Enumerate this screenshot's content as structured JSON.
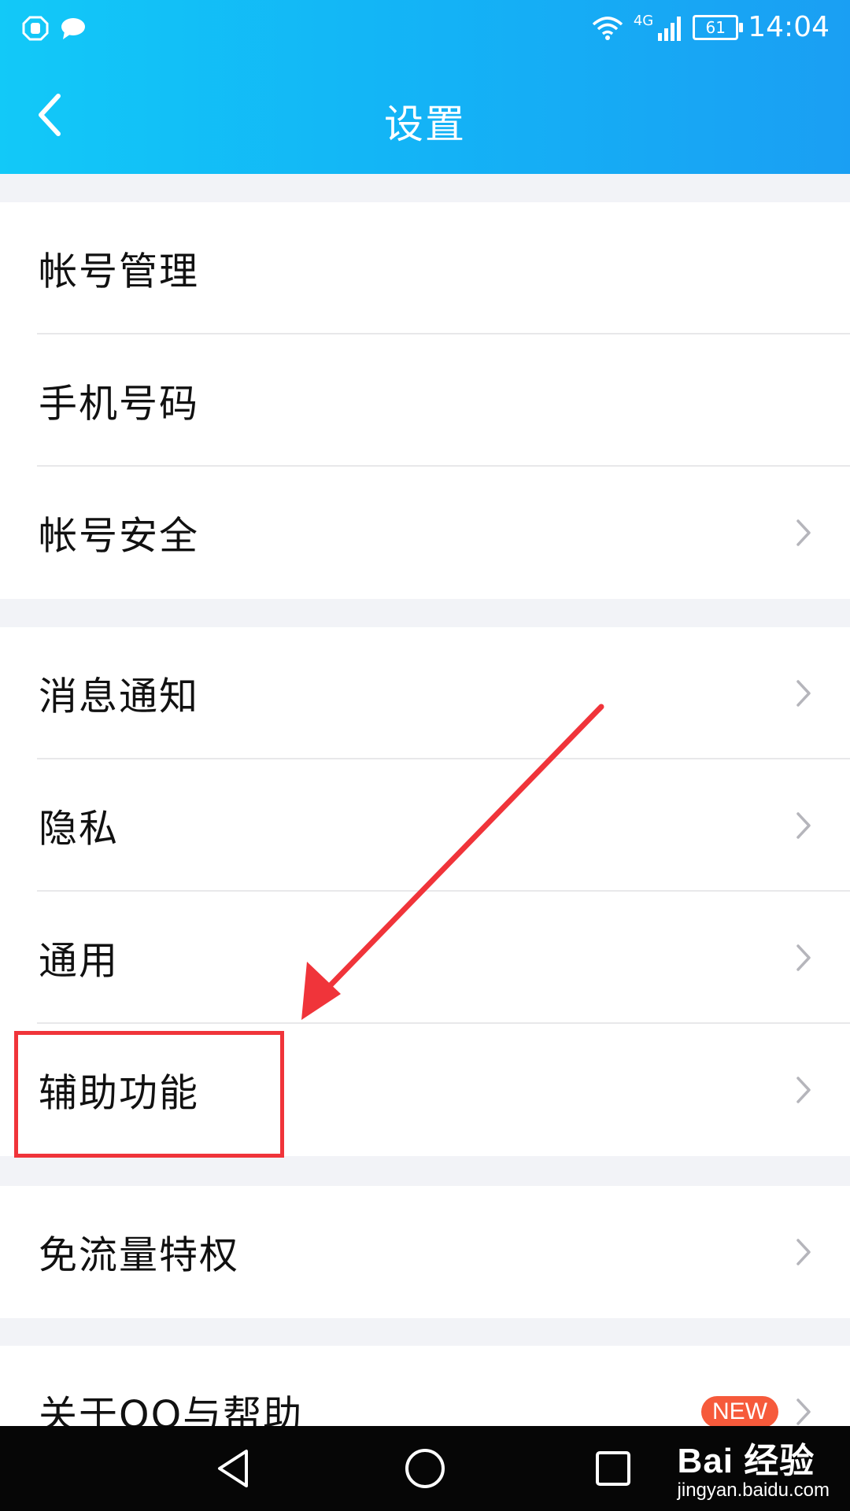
{
  "status_bar": {
    "time": "14:04",
    "battery": "61",
    "network": "4G",
    "icons": [
      "app-notification-icon",
      "message-icon",
      "wifi-icon",
      "signal-icon",
      "battery-icon"
    ]
  },
  "header": {
    "title": "设置",
    "back_icon": "back-arrow-icon",
    "gradient": [
      "#12c9f8",
      "#1a9ff3"
    ]
  },
  "groups": [
    {
      "items": [
        {
          "label": "帐号管理",
          "chevron": false
        },
        {
          "label": "手机号码",
          "chevron": false
        },
        {
          "label": "帐号安全",
          "chevron": true
        }
      ]
    },
    {
      "items": [
        {
          "label": "消息通知",
          "chevron": true
        },
        {
          "label": "隐私",
          "chevron": true
        },
        {
          "label": "通用",
          "chevron": true
        },
        {
          "label": "辅助功能",
          "chevron": true
        }
      ]
    },
    {
      "items": [
        {
          "label": "免流量特权",
          "chevron": true
        }
      ]
    },
    {
      "items": [
        {
          "label": "关于QQ与帮助",
          "chevron": true,
          "badge": "NEW"
        }
      ]
    }
  ],
  "annotation": {
    "highlight_color": "#f0343a",
    "highlighted_item": "辅助功能"
  },
  "watermark": {
    "logo": "Bai 经验",
    "url": "jingyan.baidu.com"
  },
  "system_nav": {
    "icons": [
      "back-triangle-icon",
      "home-circle-icon",
      "recents-square-icon"
    ]
  }
}
